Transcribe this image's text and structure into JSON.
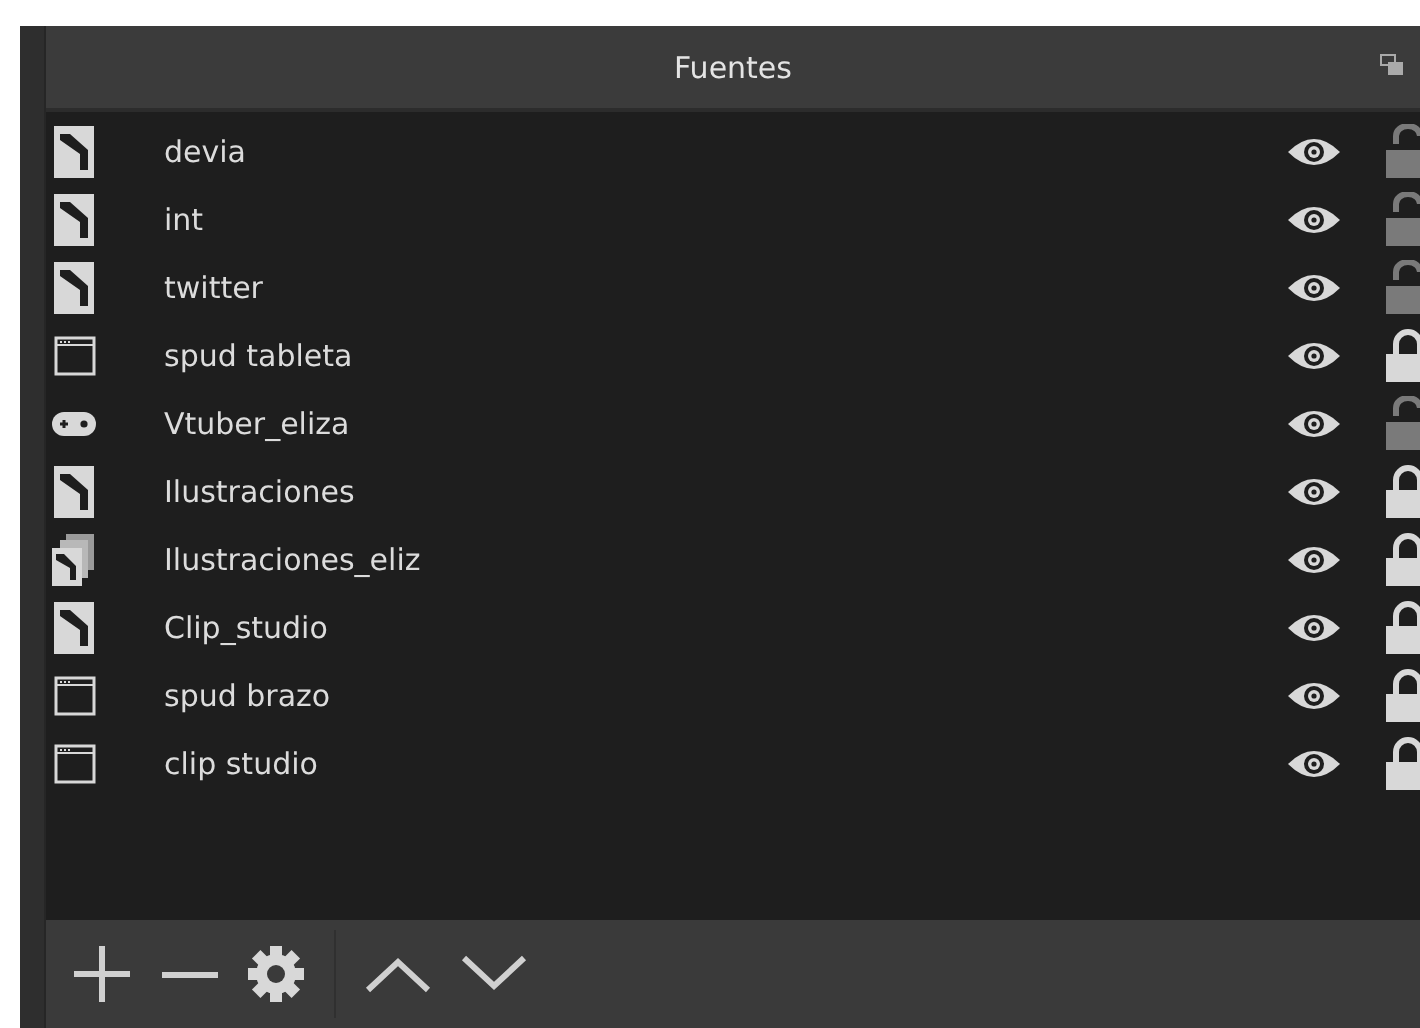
{
  "dock": {
    "title": "Fuentes"
  },
  "sources": [
    {
      "name": "devia",
      "kind": "image",
      "visible": true,
      "locked": false
    },
    {
      "name": "int",
      "kind": "image",
      "visible": true,
      "locked": false
    },
    {
      "name": "twitter",
      "kind": "image",
      "visible": true,
      "locked": false
    },
    {
      "name": "spud tableta",
      "kind": "window",
      "visible": true,
      "locked": true
    },
    {
      "name": "Vtuber_eliza",
      "kind": "game",
      "visible": true,
      "locked": false
    },
    {
      "name": "Ilustraciones",
      "kind": "image",
      "visible": true,
      "locked": true
    },
    {
      "name": "Ilustraciones_eliz",
      "kind": "slideshow",
      "visible": true,
      "locked": true
    },
    {
      "name": "Clip_studio",
      "kind": "image",
      "visible": true,
      "locked": true
    },
    {
      "name": "spud brazo",
      "kind": "window",
      "visible": true,
      "locked": true
    },
    {
      "name": "clip studio",
      "kind": "window",
      "visible": true,
      "locked": true
    }
  ]
}
